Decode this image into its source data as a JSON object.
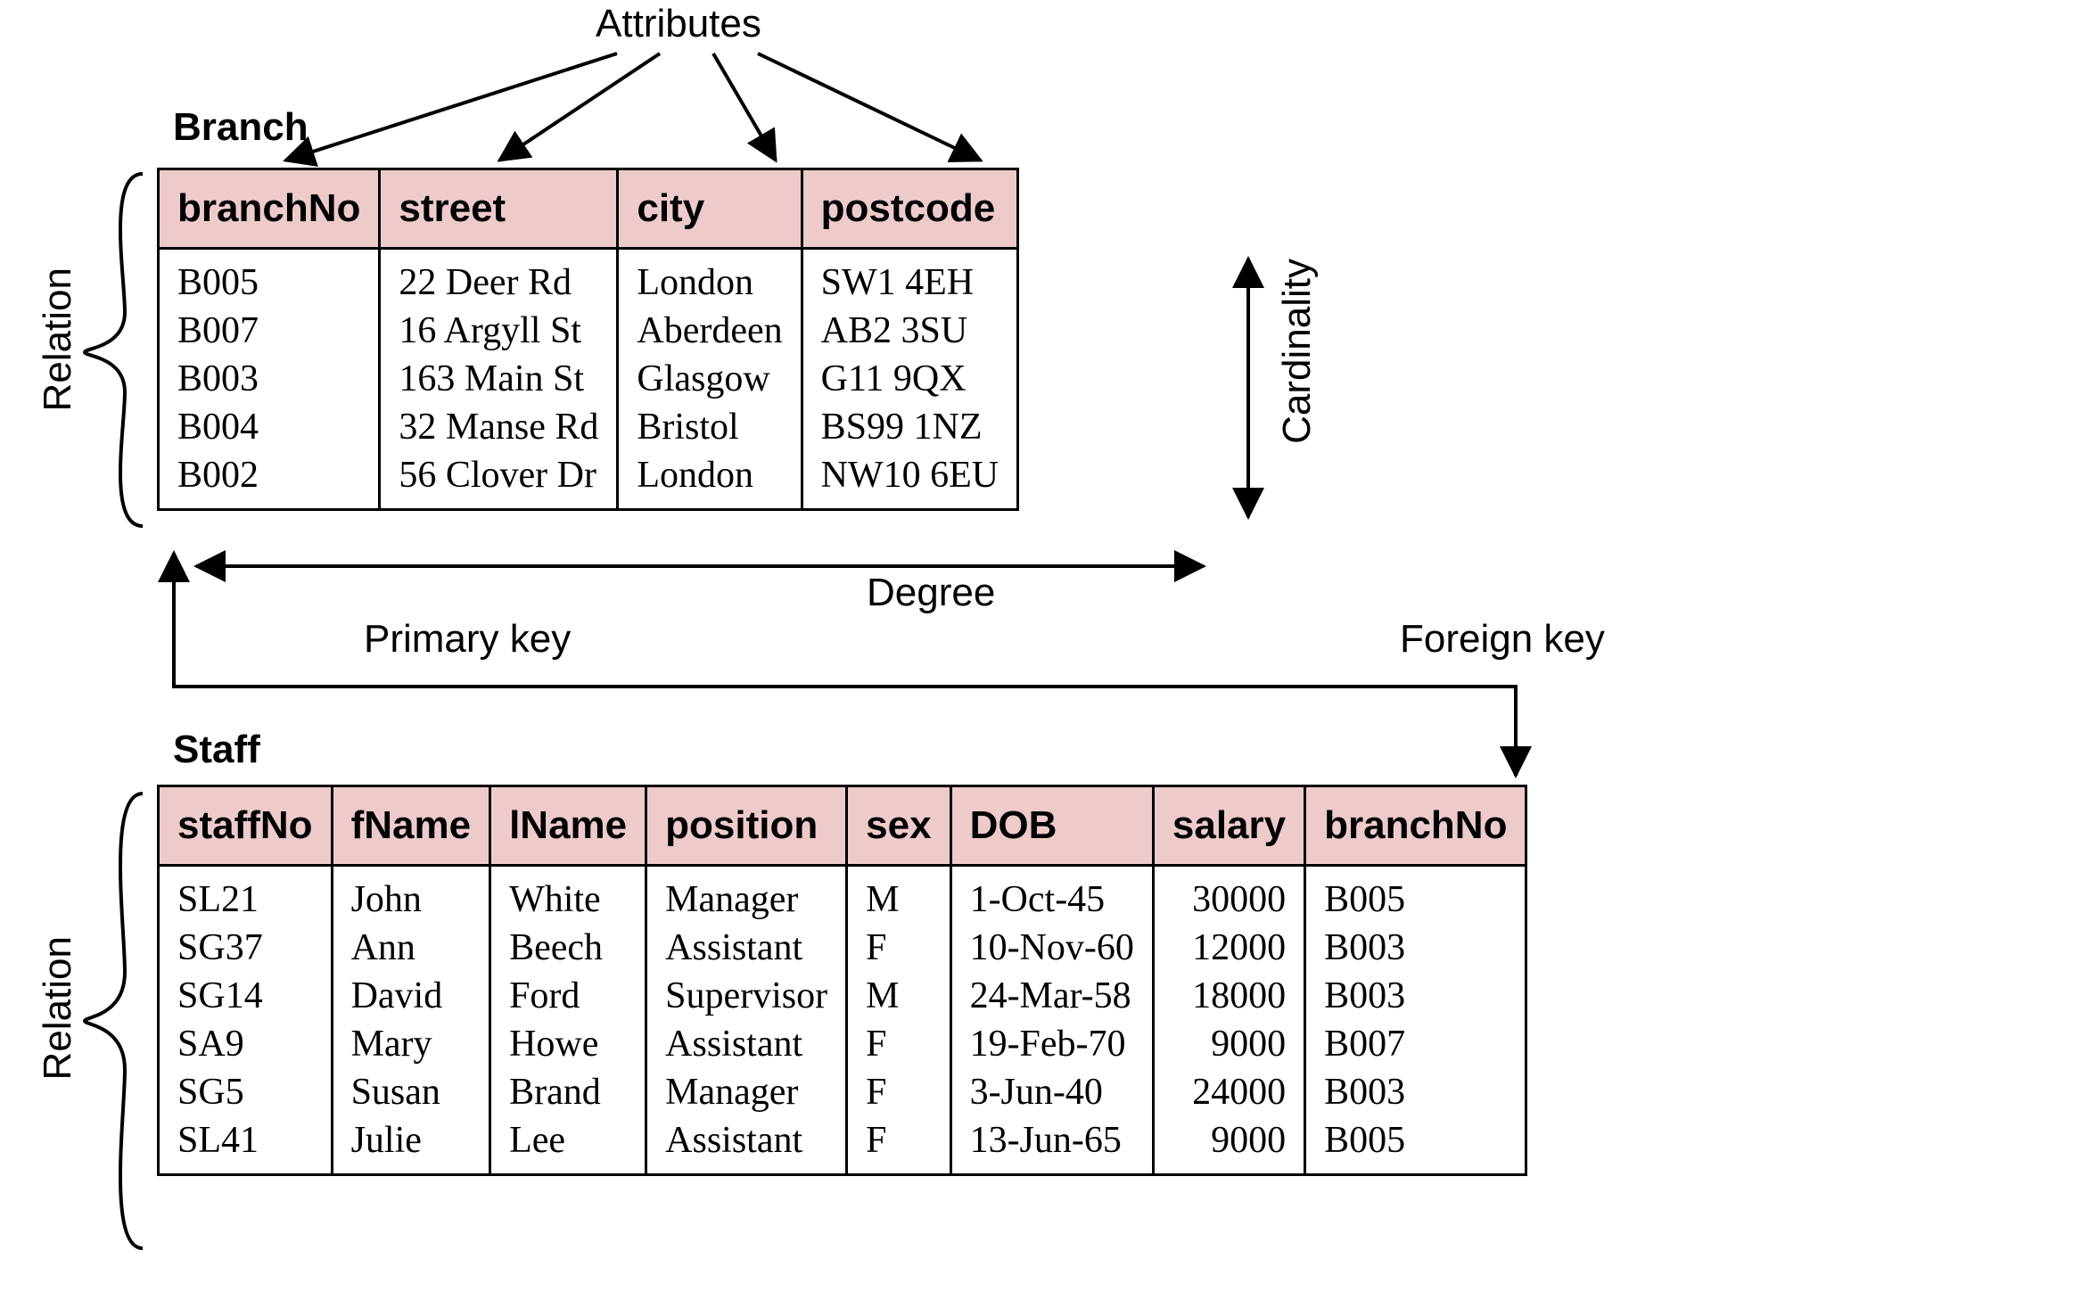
{
  "labels": {
    "attributes": "Attributes",
    "branch": "Branch",
    "staff": "Staff",
    "relation": "Relation",
    "cardinality": "Cardinality",
    "degree": "Degree",
    "primaryKey": "Primary key",
    "foreignKey": "Foreign key"
  },
  "branchTable": {
    "headers": [
      "branchNo",
      "street",
      "city",
      "postcode"
    ],
    "rows": [
      [
        "B005",
        "22 Deer Rd",
        "London",
        "SW1 4EH"
      ],
      [
        "B007",
        "16 Argyll St",
        "Aberdeen",
        "AB2 3SU"
      ],
      [
        "B003",
        "163 Main St",
        "Glasgow",
        "G11 9QX"
      ],
      [
        "B004",
        "32 Manse Rd",
        "Bristol",
        "BS99 1NZ"
      ],
      [
        "B002",
        "56 Clover Dr",
        "London",
        "NW10 6EU"
      ]
    ]
  },
  "staffTable": {
    "headers": [
      "staffNo",
      "fName",
      "lName",
      "position",
      "sex",
      "DOB",
      "salary",
      "branchNo"
    ],
    "rows": [
      [
        "SL21",
        "John",
        "White",
        "Manager",
        "M",
        "1-Oct-45",
        "30000",
        "B005"
      ],
      [
        "SG37",
        "Ann",
        "Beech",
        "Assistant",
        "F",
        "10-Nov-60",
        "12000",
        "B003"
      ],
      [
        "SG14",
        "David",
        "Ford",
        "Supervisor",
        "M",
        "24-Mar-58",
        "18000",
        "B003"
      ],
      [
        "SA9",
        "Mary",
        "Howe",
        "Assistant",
        "F",
        "19-Feb-70",
        "9000",
        "B007"
      ],
      [
        "SG5",
        "Susan",
        "Brand",
        "Manager",
        "F",
        "3-Jun-40",
        "24000",
        "B003"
      ],
      [
        "SL41",
        "Julie",
        "Lee",
        "Assistant",
        "F",
        "13-Jun-65",
        "9000",
        "B005"
      ]
    ]
  },
  "salaryRightAlignedColIndex": 6
}
